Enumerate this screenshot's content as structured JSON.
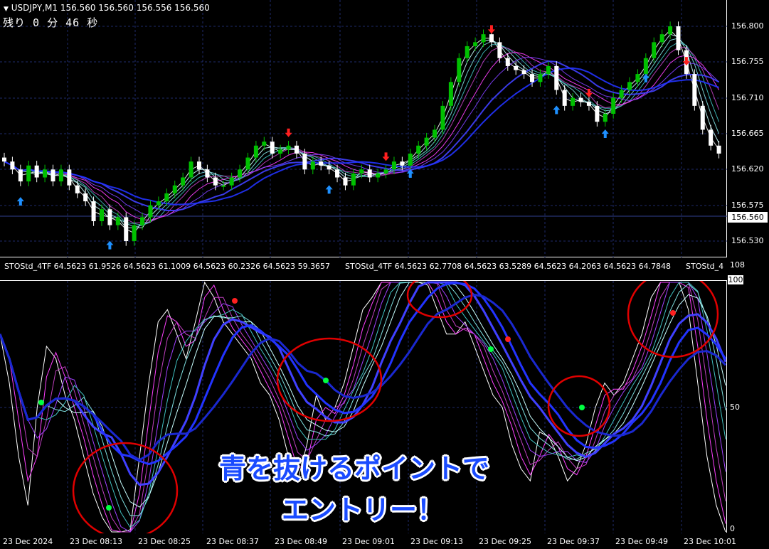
{
  "chart_header": {
    "triangle": "▼",
    "symbol_info": "USDJPY,M1  156.560 156.560 156.556 156.560",
    "countdown": "残り 0 分 46 秒"
  },
  "price_axis": {
    "ticks": [
      "156.800",
      "156.755",
      "156.710",
      "156.665",
      "156.620",
      "156.575",
      "156.530"
    ],
    "current_price": "156.560"
  },
  "oscillator": {
    "header_left": "STOStd_4TF 64.5623 61.9526 64.5623 61.1009 64.5623 60.2326 64.5623 59.3657",
    "header_mid": "STOStd_4TF 64.5623 62.7708 64.5623 63.5289 64.5623 64.2063 64.5623 64.7848",
    "header_right": "STOStd_4",
    "ticks": {
      "top": "108",
      "hundred": "100",
      "fifty": "50",
      "zero": "0"
    }
  },
  "time_axis": [
    "23 Dec 2024",
    "23 Dec 08:13",
    "23 Dec 08:25",
    "23 Dec 08:37",
    "23 Dec 08:49",
    "23 Dec 09:01",
    "23 Dec 09:13",
    "23 Dec 09:25",
    "23 Dec 09:37",
    "23 Dec 09:49",
    "23 Dec 10:01"
  ],
  "annotation": {
    "line1": "青を抜けるポイントで",
    "line2": "エントリー！"
  },
  "colors": {
    "bull": "#00c000",
    "bear": "#ffffff",
    "buy_arrow": "#1e90ff",
    "sell_arrow": "#ff2020",
    "ma_slow": "#2233ff",
    "circle": "#e00000"
  },
  "chart_data": {
    "type": "candlestick",
    "symbol": "USDJPY",
    "timeframe": "M1",
    "y_range": [
      156.52,
      156.82
    ],
    "closes": [
      156.63,
      156.62,
      156.605,
      156.625,
      156.61,
      156.62,
      156.605,
      156.62,
      156.6,
      156.59,
      156.58,
      156.555,
      156.57,
      156.55,
      156.56,
      156.53,
      156.55,
      156.56,
      156.575,
      156.58,
      156.59,
      156.6,
      156.61,
      156.63,
      156.62,
      156.61,
      156.6,
      156.6,
      156.61,
      156.62,
      156.635,
      156.65,
      156.655,
      156.64,
      156.645,
      156.65,
      156.64,
      156.62,
      156.63,
      156.625,
      156.62,
      156.61,
      156.6,
      156.615,
      156.62,
      156.61,
      156.615,
      156.62,
      156.63,
      156.625,
      156.64,
      156.65,
      156.66,
      156.67,
      156.7,
      156.73,
      156.76,
      156.775,
      156.78,
      156.79,
      156.78,
      156.76,
      156.75,
      156.745,
      156.74,
      156.73,
      156.74,
      156.75,
      156.72,
      156.7,
      156.71,
      156.705,
      156.7,
      156.68,
      156.69,
      156.71,
      156.72,
      156.73,
      156.74,
      156.76,
      156.78,
      156.79,
      156.8,
      156.77,
      156.74,
      156.7,
      156.67,
      156.65,
      156.64
    ]
  }
}
